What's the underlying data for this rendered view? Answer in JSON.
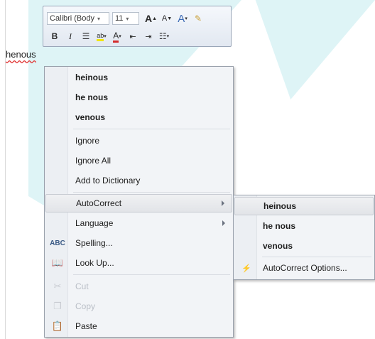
{
  "document": {
    "misspelled_word": "henous"
  },
  "mini_toolbar": {
    "font_name": "Calibri (Body",
    "font_size": "11",
    "grow_font_label": "A",
    "shrink_font_label": "A",
    "bold_label": "B",
    "italic_label": "I",
    "font_color_label": "A",
    "icons": [
      "grow-font-icon",
      "shrink-font-icon",
      "styles-icon",
      "format-painter-icon",
      "center-align-icon",
      "highlight-icon",
      "font-color-icon",
      "decrease-indent-icon",
      "increase-indent-icon",
      "bullets-icon"
    ]
  },
  "context_menu": {
    "suggestions": [
      "heinous",
      "he nous",
      "venous"
    ],
    "ignore_label": "Ignore",
    "ignore_all_label": "Ignore All",
    "add_to_dictionary_label": "Add to Dictionary",
    "autocorrect_label": "AutoCorrect",
    "language_label": "Language",
    "spelling_label": "Spelling...",
    "lookup_label": "Look Up...",
    "cut_label": "Cut",
    "copy_label": "Copy",
    "paste_label": "Paste"
  },
  "autocorrect_submenu": {
    "suggestions": [
      "heinous",
      "he nous",
      "venous"
    ],
    "options_label": "AutoCorrect Options..."
  },
  "colors": {
    "menu_background": "#f2f4f7",
    "hover_highlight": "#e2e4e8",
    "background_accent": "#2fb8c8",
    "spelling_underline": "#e0302f"
  }
}
